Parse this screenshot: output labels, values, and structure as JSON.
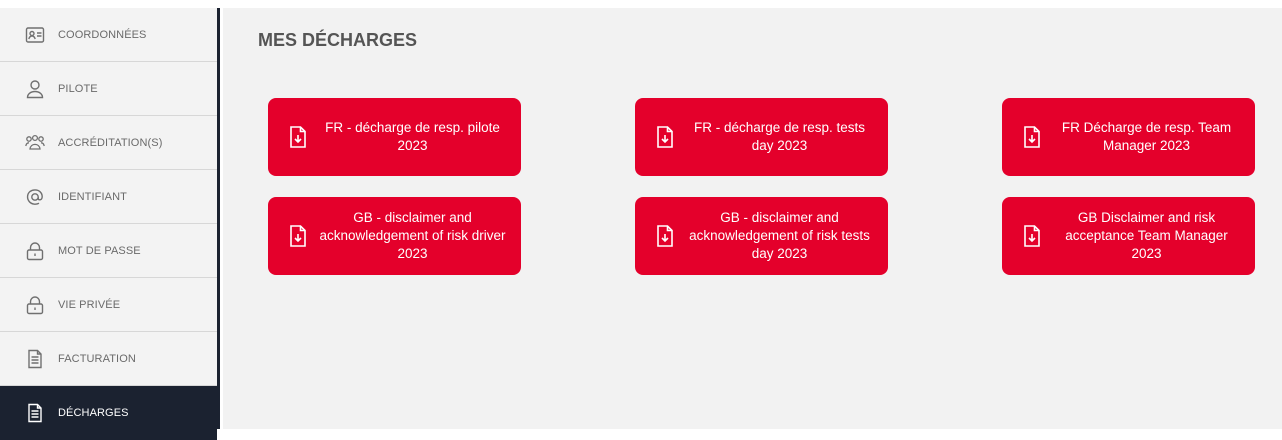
{
  "sidebar": {
    "items": [
      {
        "label": "COORDONNÉES",
        "icon": "contact-card-icon"
      },
      {
        "label": "PILOTE",
        "icon": "user-icon"
      },
      {
        "label": "ACCRÉDITATION(S)",
        "icon": "users-group-icon"
      },
      {
        "label": "IDENTIFIANT",
        "icon": "at-sign-icon"
      },
      {
        "label": "MOT DE PASSE",
        "icon": "lock-icon"
      },
      {
        "label": "VIE PRIVÉE",
        "icon": "lock-icon"
      },
      {
        "label": "FACTURATION",
        "icon": "document-icon"
      },
      {
        "label": "DÉCHARGES",
        "icon": "document-icon",
        "active": true
      }
    ]
  },
  "main": {
    "title": "MES DÉCHARGES",
    "documents": [
      {
        "label": "FR - décharge de resp. pilote 2023",
        "icon": "file-download-icon"
      },
      {
        "label": "FR - décharge de resp. tests day 2023",
        "icon": "file-download-icon"
      },
      {
        "label": "FR Décharge de resp. Team Manager 2023",
        "icon": "file-download-icon"
      },
      {
        "label": "GB - disclaimer and acknowledgement of risk driver 2023",
        "icon": "file-download-icon"
      },
      {
        "label": "GB - disclaimer and acknowledgement of risk tests day 2023",
        "icon": "file-download-icon"
      },
      {
        "label": "GB Disclaimer and risk acceptance Team Manager 2023",
        "icon": "file-download-icon"
      }
    ]
  },
  "colors": {
    "accent": "#e4002b",
    "sidebar_active_bg": "#1b2230",
    "content_bg": "#f2f2f2"
  }
}
